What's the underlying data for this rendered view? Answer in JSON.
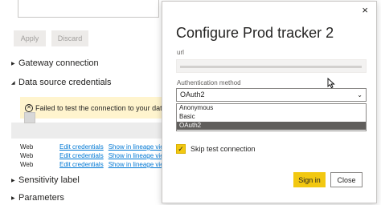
{
  "background": {
    "apply_label": "Apply",
    "discard_label": "Discard",
    "sections": {
      "gateway": "Gateway connection",
      "credentials": "Data source credentials",
      "sensitivity": "Sensitivity label",
      "parameters": "Parameters"
    },
    "error_message": "Failed to test the connection to your data s",
    "sources": [
      {
        "type": "Web",
        "edit": "Edit credentials",
        "lineage": "Show in lineage view"
      },
      {
        "type": "Web",
        "edit": "Edit credentials",
        "lineage": "Show in lineage view"
      },
      {
        "type": "Web",
        "edit": "Edit credentials",
        "lineage": "Show in lineage view"
      }
    ]
  },
  "dialog": {
    "title": "Configure Prod tracker 2",
    "url_label": "url",
    "auth_label": "Authentication method",
    "auth_selected": "OAuth2",
    "auth_options": [
      "Anonymous",
      "Basic",
      "OAuth2"
    ],
    "skip_test_label": "Skip test connection",
    "skip_test_checked": true,
    "sign_in_label": "Sign in",
    "close_label": "Close"
  },
  "colors": {
    "accent_yellow": "#f2c811",
    "link_blue": "#0078d4",
    "error_background": "#fff4ce"
  }
}
